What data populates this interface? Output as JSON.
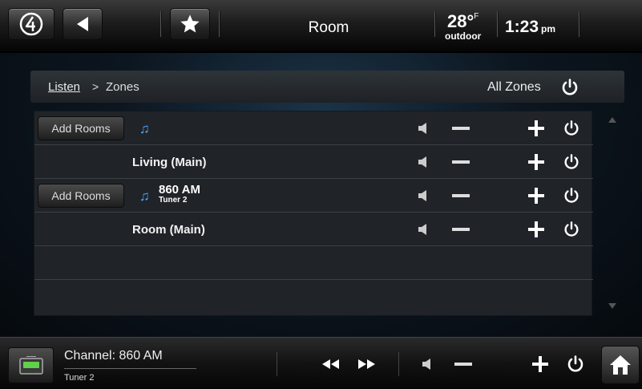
{
  "header": {
    "room_title": "Room",
    "temperature": "28°",
    "temperature_unit": "F",
    "temperature_label": "outdoor",
    "time": "1:23",
    "ampm": "pm"
  },
  "breadcrumb": {
    "link": "Listen",
    "separator": ">",
    "current": "Zones",
    "all_zones_label": "All Zones"
  },
  "zones": [
    {
      "add_rooms_label": "Add Rooms",
      "source_name": "",
      "source_detail": "",
      "zone_name": ""
    },
    {
      "add_rooms_label": "",
      "source_name": "",
      "source_detail": "",
      "zone_name": "Living  (Main)"
    },
    {
      "add_rooms_label": "Add Rooms",
      "source_name": "860 AM",
      "source_detail": "Tuner 2",
      "zone_name": ""
    },
    {
      "add_rooms_label": "",
      "source_name": "",
      "source_detail": "",
      "zone_name": "Room  (Main)"
    }
  ],
  "now_playing": {
    "title": "Channel: 860 AM",
    "subtitle": "Tuner 2"
  },
  "icons": {
    "logo": "logo-icon",
    "back": "back-arrow-icon",
    "favorites": "star-icon",
    "power": "power-icon",
    "mute": "speaker-icon",
    "volume_down": "minus-icon",
    "volume_up": "plus-icon",
    "music": "music-note-icon",
    "rewind": "rewind-icon",
    "fast_forward": "fast-forward-icon",
    "tuner": "tuner-icon",
    "home": "home-icon"
  },
  "colors": {
    "accent": "#4aa3ff",
    "tuner_green": "#5fd14a"
  }
}
